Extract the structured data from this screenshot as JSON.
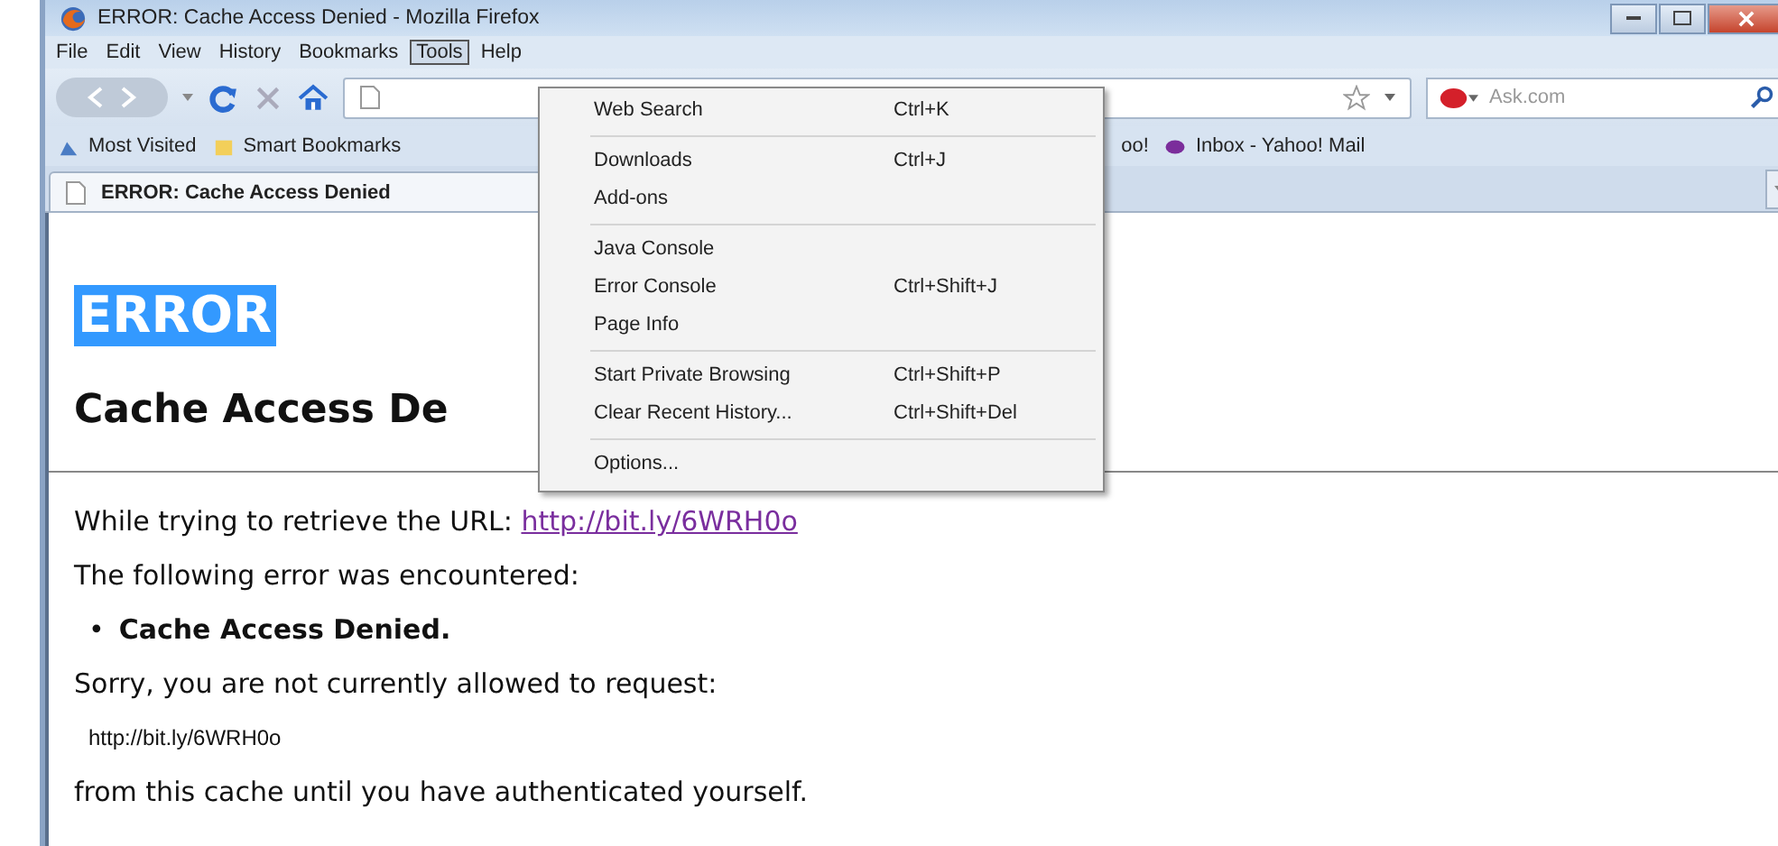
{
  "window": {
    "title": "ERROR: Cache Access Denied - Mozilla Firefox"
  },
  "menu_bar": [
    {
      "label": "File",
      "selected": false
    },
    {
      "label": "Edit",
      "selected": false
    },
    {
      "label": "View",
      "selected": false
    },
    {
      "label": "History",
      "selected": false
    },
    {
      "label": "Bookmarks",
      "selected": false
    },
    {
      "label": "Tools",
      "selected": true
    },
    {
      "label": "Help",
      "selected": false
    }
  ],
  "search": {
    "placeholder": "Ask.com"
  },
  "bookmarks": [
    {
      "label": "Most Visited",
      "kind": "feed"
    },
    {
      "label": "Smart Bookmarks",
      "kind": "folder"
    },
    {
      "label": "oo!",
      "kind": "plain"
    },
    {
      "label": "Inbox - Yahoo! Mail",
      "kind": "yahoo"
    }
  ],
  "tab": {
    "title": "ERROR: Cache Access Denied"
  },
  "tools_menu": [
    [
      {
        "label": "Web Search",
        "shortcut": "Ctrl+K"
      }
    ],
    [
      {
        "label": "Downloads",
        "shortcut": "Ctrl+J"
      },
      {
        "label": "Add-ons"
      }
    ],
    [
      {
        "label": "Java Console"
      },
      {
        "label": "Error Console",
        "shortcut": "Ctrl+Shift+J"
      },
      {
        "label": "Page Info"
      }
    ],
    [
      {
        "label": "Start Private Browsing",
        "shortcut": "Ctrl+Shift+P"
      },
      {
        "label": "Clear Recent History...",
        "shortcut": "Ctrl+Shift+Del"
      }
    ],
    [
      {
        "label": "Options..."
      }
    ]
  ],
  "page": {
    "heading": "ERROR",
    "heading_selected": true,
    "subheading": "Cache Access De",
    "url_line": "While trying to retrieve the URL: ",
    "url_link": "http://bit.ly/6WRH0o",
    "error_line": "The following error was encountered:",
    "bullet_mark": "•",
    "bullet": "Cache Access Denied.",
    "sorry_line": "Sorry, you are not currently allowed to request:",
    "requested_url": "http://bit.ly/6WRH0o",
    "until_line": "from this cache until you have authenticated yourself."
  }
}
